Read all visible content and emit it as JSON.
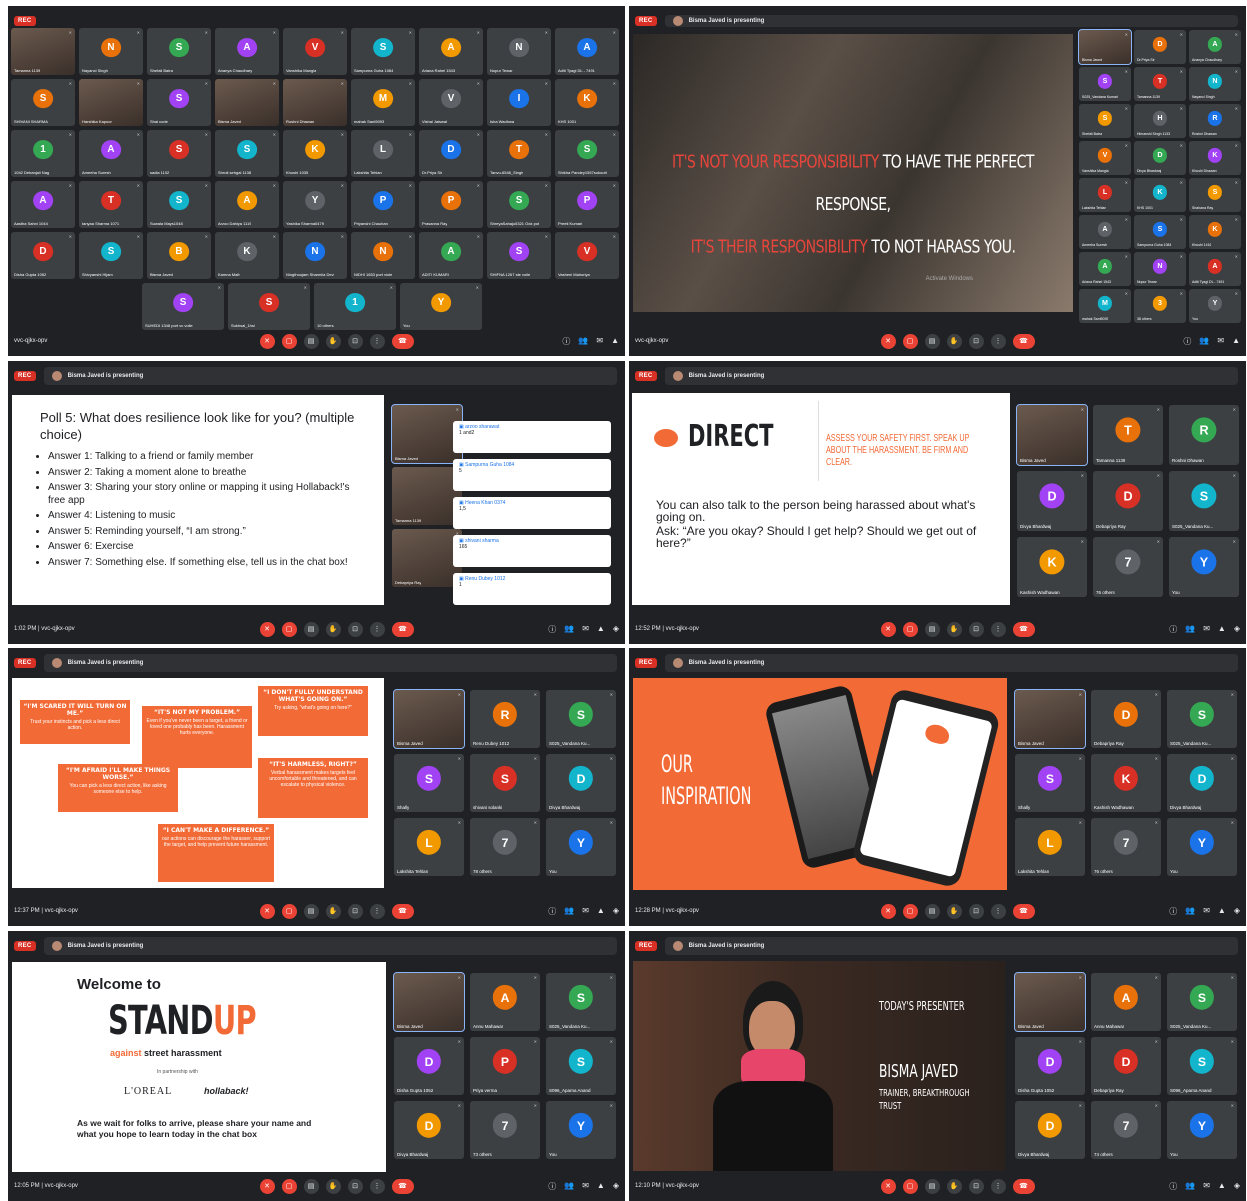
{
  "meeting_code": "vvc-qjkx-opv",
  "presenter_bar": "Bisma Javed is presenting",
  "rec": "REC",
  "controls": [
    "mic-off",
    "cam-off",
    "cc",
    "hand",
    "present",
    "more",
    "end"
  ],
  "p1": {
    "grid": [
      "Tamanna 1139",
      "Nayanci Singh",
      "Shefali Batra",
      "Ananya Chaudhary",
      "Vanshika Mangla",
      "Sampurna Guha 1084",
      "Ariana Rahel 1543",
      "Nupur Tewar",
      "Aditi Tyagi DL - 7491",
      "SHIVANI SHARMA",
      "Harshika Kapoor",
      "Shai code",
      "Bisma Javed",
      "Roshni Dhawan",
      "mahak Sant5093",
      "Vishal Jaiswal",
      "Isha Wadhwa",
      "KHS 1001",
      "1042 Debanjali Nag",
      "Ameeha Suresh",
      "sadia 1102",
      "Shruti sehgal 1138",
      "Khushi 1035",
      "Lakshita Tehlan",
      "Dr.Priya Sir",
      "Tanvu-6548_Singh",
      "Shikha Pandey1557sokoutt",
      "Aastha Sahni 1044",
      "tanyaa Sharma 1071",
      "Suwala Mays1048",
      "Arzoo Dahiya 1119",
      "Yashika Sharma0479",
      "Priyanshi Chauhan",
      "Prasanna Ray",
      "ShreyaSahaju5321 Odz pot",
      "Preeti Kumari",
      "Disha Gupta 1052",
      "Shivyanshi Hijam",
      "Bisma Javed",
      "Kamna Malh",
      "Ningthoujam Sharmila Devi",
      "NIDHI 1653 port viole",
      "ADITI KUMARI",
      "SHIFNA 1267 ste voile",
      "Vasheni Mahoriya"
    ],
    "lastrow": [
      "SUHEDI 1348 port vc voile",
      "Sukhsal_1hsl",
      "10 others",
      "You"
    ]
  },
  "p2": {
    "quote_red1": "IT'S NOT YOUR RESPONSIBILITY",
    "quote_white1": "TO HAVE THE PERFECT RESPONSE,",
    "quote_red2": "IT'S THEIR RESPONSIBILITY",
    "quote_white2": "TO NOT HARASS YOU.",
    "watermark": "Activate Windows",
    "side": [
      "Bisma Javed",
      "Dr.Priya Sir",
      "Ananya Chaudhary",
      "S025_Vandana Kumari",
      "Tamanna 1139",
      "Nayanci Singh",
      "Shefali Batra",
      "Himanshi Singh 1133",
      "Roshni Dhawan",
      "Vanshika Mangla",
      "Divya Bhardwaj",
      "Khushi Dhawan",
      "Lakshita Tehlan",
      "KHS 1001",
      "Shahana Ray",
      "Ameeha Suresh",
      "Sampurna Guha 1084",
      "Khushi 1416",
      "Ariana Rahel 1543",
      "Nupur Tewar",
      "Aditi Tyagi DL - 7491",
      "mahak Sant5093",
      "38 others",
      "You"
    ]
  },
  "p3": {
    "time": "1:02 PM",
    "title": "Poll 5: What does resilience look like for you? (multiple choice)",
    "answers": [
      "Answer 1: Talking to a friend or family member",
      "Answer 2: Taking a moment alone to breathe",
      "Answer 3: Sharing your story online or mapping it using Hollaback!'s free app",
      "Answer 4: Listening to music",
      "Answer 5: Reminding yourself, “I am strong.”",
      "Answer 6: Exercise",
      "Answer 7: Something else. If something else, tell us in the chat box!"
    ],
    "chat": [
      {
        "u": "arzoo sharawat",
        "m": "1 and2"
      },
      {
        "u": "Sampurna Guha 1084",
        "m": "5"
      },
      {
        "u": "Heena Khan 0374",
        "m": "1,5"
      },
      {
        "u": "shivani sharma",
        "m": "165"
      },
      {
        "u": "Renu Dubey 1012",
        "m": "1"
      }
    ],
    "tiles": [
      "Bisma Javed",
      "Tamanna 1139",
      "Debapriya Ray"
    ]
  },
  "p4": {
    "time": "12:52 PM",
    "heading": "DIRECT",
    "sub": "ASSESS YOUR SAFETY FIRST. SPEAK UP ABOUT THE HARASSMENT. BE FIRM AND CLEAR.",
    "body": "You can also talk to the person being harassed about what's going on.",
    "ask": "Ask: “Are you okay? Should I get help? Should we get out of here?”",
    "tiles": [
      "Bisma Javed",
      "Tamanna 1139",
      "Roshni Dhawan",
      "Divya Bhardwaj",
      "Debapriya Ray",
      "S025_Vandana Ku...",
      "Kashish Wadhawan",
      "76 others",
      "You"
    ]
  },
  "p5": {
    "time": "12:37 PM",
    "blocks": [
      {
        "t": "“I'M SCARED IT WILL TURN ON ME.”",
        "b": "Trust your instincts and pick a less direct action."
      },
      {
        "t": "“IT'S NOT MY PROBLEM.”",
        "b": "Even if you've never been a target, a friend or loved one probably has been. Harassment hurts everyone."
      },
      {
        "t": "“I DON'T FULLY UNDERSTAND WHAT'S GOING ON.”",
        "b": "Try asking, “what's going on here?”"
      },
      {
        "t": "“I'M AFRAID I'LL MAKE THINGS WORSE.”",
        "b": "You can pick a less direct action, like asking someone else to help."
      },
      {
        "t": "“IT'S HARMLESS, RIGHT?”",
        "b": "Verbal harassment makes targets feel uncomfortable and threatened, and can escalate to physical violence."
      },
      {
        "t": "“I CAN'T MAKE A DIFFERENCE.”",
        "b": "our actions can discourage the harasser, support the target, and help prevent future harassment."
      }
    ],
    "tiles": [
      "Bisma Javed",
      "Renu Dubey 1012",
      "S025_Vandana Ku...",
      "Shally",
      "shivani solanki",
      "Divya Bhardwaj",
      "Lakshita Tehlan",
      "78 others",
      "You"
    ]
  },
  "p6": {
    "time": "12:28 PM",
    "our": "OUR",
    "insp": "INSPIRATION",
    "tiles": [
      "Bisma Javed",
      "Debapriya Ray",
      "S025_Vandana Ku...",
      "Shally",
      "Kashish Wadhawan",
      "Divya Bhardwaj",
      "Lakshita Tehlan",
      "76 others",
      "You"
    ]
  },
  "p7": {
    "time": "12:05 PM",
    "welcome": "Welcome to",
    "stand": "STAND",
    "up": "UP",
    "against": "against",
    "street": "street harassment",
    "partner": "In partnership with",
    "loreal": "L'OREAL",
    "hollaback": "hollaback!",
    "wait": "As we wait for folks to arrive, please share your name and what you hope to learn today in the chat box",
    "tiles": [
      "Bisma Javed",
      "Annu Mahawar",
      "S025_Vandana Ku...",
      "Disha Gupta 1052",
      "Priya verma",
      "S096_Aparna Anand",
      "Divya Bhardwaj",
      "73 others",
      "You"
    ]
  },
  "p8": {
    "time": "12:10 PM",
    "today": "TODAY'S PRESENTER",
    "name": "BISMA JAVED",
    "role": "TRAINER, BREAKTHROUGH TRUST",
    "tiles": [
      "Bisma Javed",
      "Annu Mahawar",
      "S025_Vandana Ku...",
      "Disha Gupta 1052",
      "Debapriya Ray",
      "S096_Aparna Anand",
      "Divya Bhardwaj",
      "74 others",
      "You"
    ]
  },
  "colors": {
    "accent": "#f26a36",
    "meet_bg": "#202124",
    "tile": "#3c4043",
    "red": "#ea4335"
  }
}
